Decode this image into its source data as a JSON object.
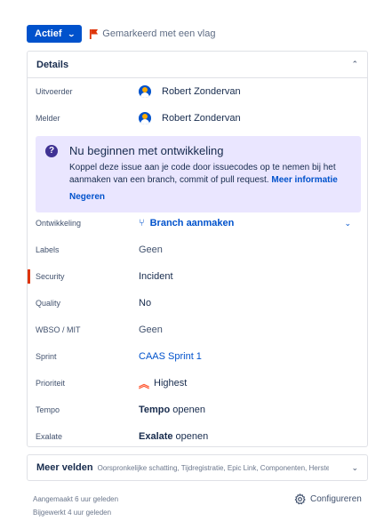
{
  "status": {
    "label": "Actief"
  },
  "flag": {
    "label": "Gemarkeerd met een vlag",
    "color": "#de350b"
  },
  "details": {
    "title": "Details",
    "assignee": {
      "label": "Uitvoerder",
      "value": "Robert Zondervan"
    },
    "reporter": {
      "label": "Melder",
      "value": "Robert Zondervan"
    },
    "promo": {
      "title": "Nu beginnen met ontwikkeling",
      "body": "Koppel deze issue aan je code door issuecodes op te nemen bij het aanmaken van een branch, commit of pull request.",
      "link": "Meer informatie",
      "dismiss": "Negeren"
    },
    "fields": {
      "development": {
        "label": "Ontwikkeling",
        "value": "Branch aanmaken"
      },
      "labels": {
        "label": "Labels",
        "value": "Geen"
      },
      "security": {
        "label": "Security",
        "value": "Incident"
      },
      "quality": {
        "label": "Quality",
        "value": "No"
      },
      "wbso": {
        "label": "WBSO / MIT",
        "value": "Geen"
      },
      "sprint": {
        "label": "Sprint",
        "value": "CAAS Sprint 1"
      },
      "priority": {
        "label": "Prioriteit",
        "value": "Highest"
      },
      "tempo": {
        "label": "Tempo",
        "bold": "Tempo",
        "rest": "openen"
      },
      "exalate": {
        "label": "Exalate",
        "bold": "Exalate",
        "rest": "openen"
      }
    }
  },
  "more_fields": {
    "title": "Meer velden",
    "summary": "Oorspronkelijke schatting, Tijdregistratie, Epic Link, Componenten, Herstelvers..."
  },
  "footer": {
    "created": "Aangemaakt 6 uur geleden",
    "updated": "Bijgewerkt 4 uur geleden",
    "configure": "Configureren"
  },
  "colors": {
    "primary": "#0052cc",
    "promo_bg": "#eae6ff",
    "priority": "#ff5630"
  }
}
